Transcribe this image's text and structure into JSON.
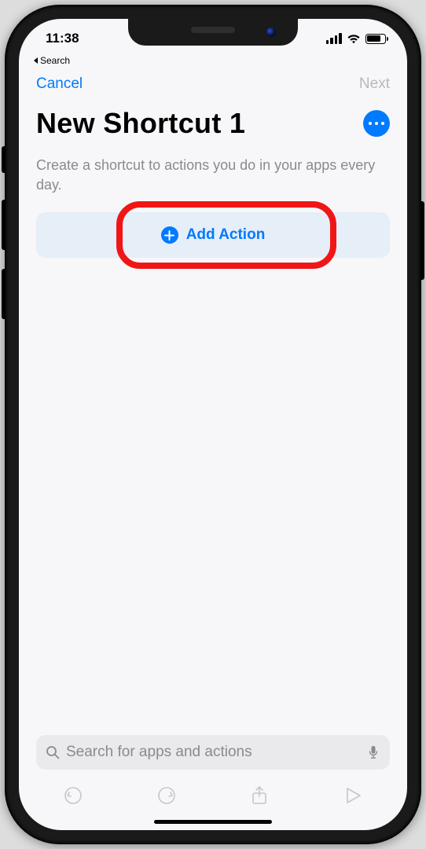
{
  "status": {
    "time": "11:38",
    "back_label": "Search"
  },
  "nav": {
    "cancel": "Cancel",
    "next": "Next"
  },
  "header": {
    "title": "New Shortcut 1",
    "subtitle": "Create a shortcut to actions you do in your apps every day."
  },
  "main": {
    "add_action_label": "Add Action"
  },
  "search": {
    "placeholder": "Search for apps and actions"
  },
  "colors": {
    "tint": "#007aff",
    "highlight": "#f01616"
  }
}
